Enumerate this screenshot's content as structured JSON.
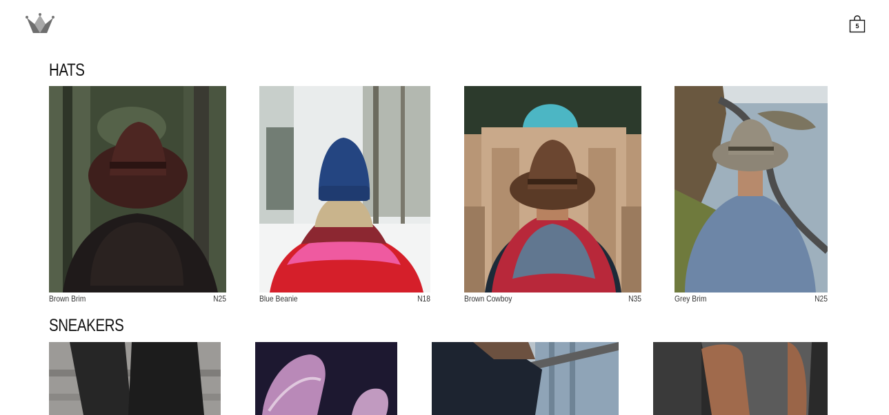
{
  "header": {
    "logo": "crown-logo-icon",
    "cart": {
      "icon": "shopping-bag-icon",
      "count": "5"
    }
  },
  "sections": [
    {
      "title": "HATS",
      "items": [
        {
          "name": "Brown Brim",
          "price": "N25"
        },
        {
          "name": "Blue Beanie",
          "price": "N18"
        },
        {
          "name": "Brown Cowboy",
          "price": "N35"
        },
        {
          "name": "Grey Brim",
          "price": "N25"
        }
      ]
    },
    {
      "title": "SNEAKERS",
      "items": [
        {
          "name": "",
          "price": ""
        },
        {
          "name": "",
          "price": ""
        },
        {
          "name": "",
          "price": ""
        },
        {
          "name": "",
          "price": ""
        }
      ]
    }
  ]
}
